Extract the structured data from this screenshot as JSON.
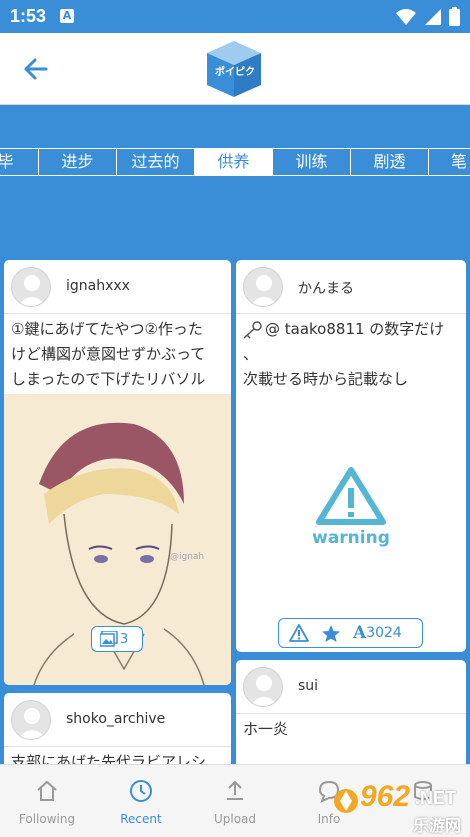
{
  "status_bar": {
    "time": "1:53",
    "notification_glyph": "A",
    "icons": [
      "wifi-icon",
      "signal-icon",
      "battery-icon"
    ]
  },
  "header": {
    "logo_text": "ポイピク",
    "back_icon": "arrow-left-icon"
  },
  "tags": [
    "毕",
    "进步",
    "过去的",
    "供养",
    "训练",
    "剧透",
    "笔"
  ],
  "active_tag": "供养",
  "posts": [
    {
      "user": "ignahxxx",
      "text_lines": [
        "①鍵にあげてたやつ②作った",
        "けど構図が意図せずかぶって",
        "しまったので下げたリバソル"
      ],
      "image_count": "3"
    },
    {
      "user": "かんまる",
      "text_lines": [
        "@ taako8811 の数字だけ",
        "、",
        "次載せる時から記載なし"
      ],
      "warning_label": "warning",
      "reaction_count": "3024"
    },
    {
      "user": "sui",
      "text_lines": [
        "ホ一炎"
      ]
    },
    {
      "user": "shoko_archive",
      "text_lines": [
        "支部にあげた先代ラビアレシ"
      ]
    }
  ],
  "nav": [
    "Following",
    "Recent",
    "Upload",
    "Info",
    ""
  ],
  "active_nav": "Recent",
  "watermark": {
    "number": "962",
    "suffix": ".NET",
    "caption": "乐游网"
  },
  "colors": {
    "accent": "#3a8ed8",
    "background": "#ffffff",
    "muted": "#999999",
    "watermark_orange": "#f5a623"
  }
}
